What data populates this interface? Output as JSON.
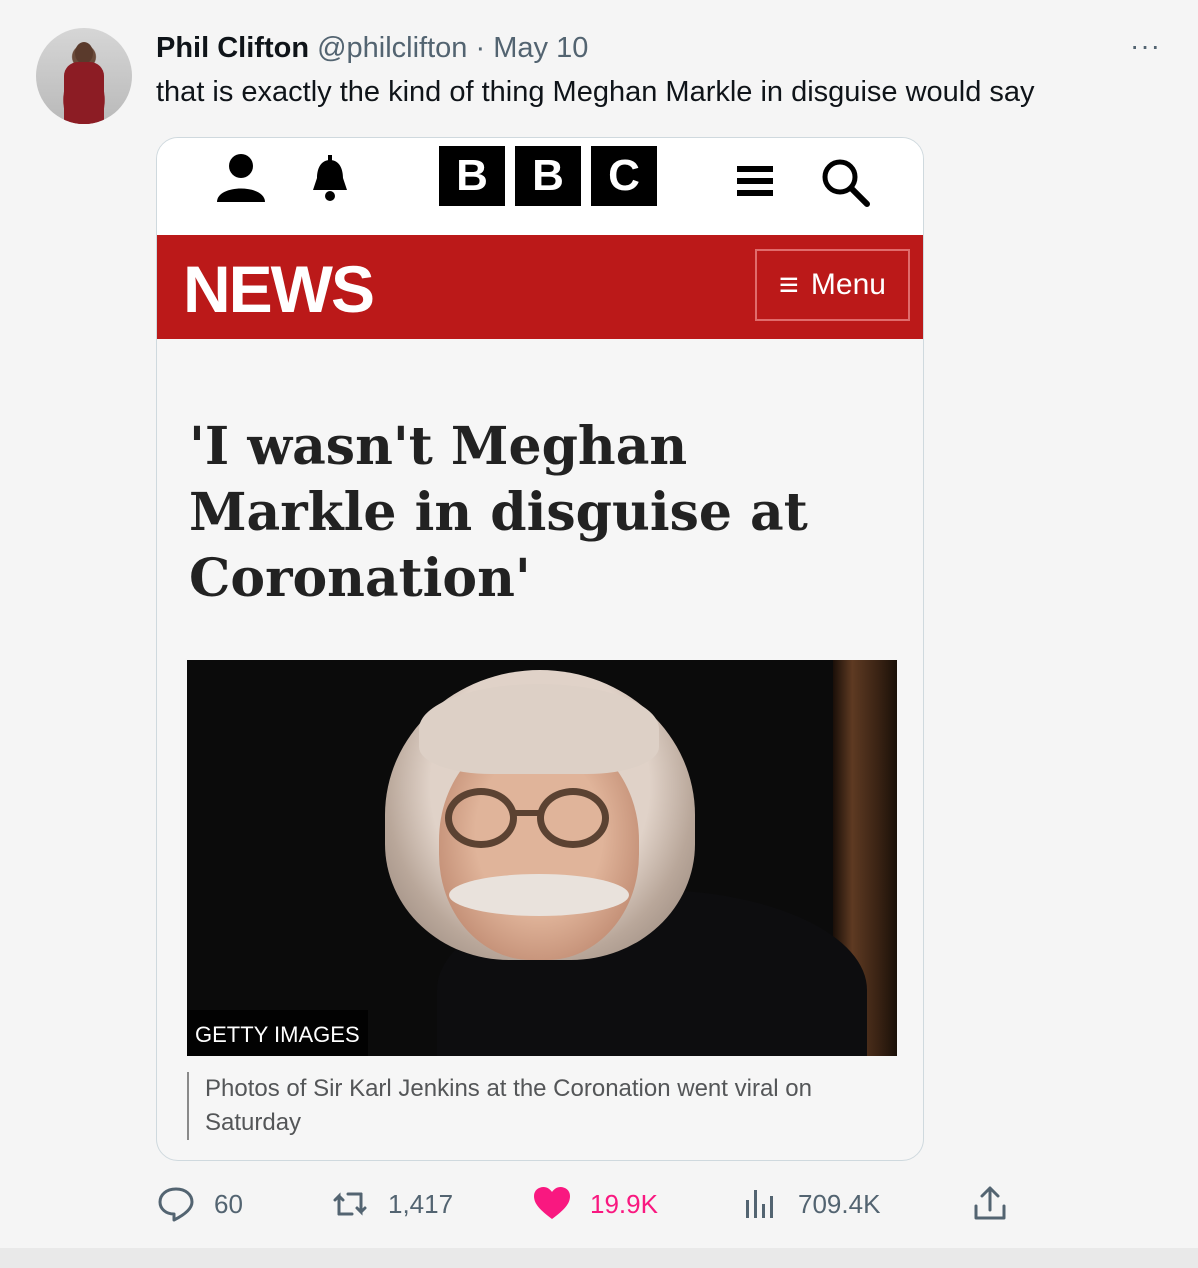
{
  "tweet": {
    "author_name": "Phil Clifton",
    "handle": "@philclifton",
    "separator": "·",
    "date": "May 10",
    "text": "that is exactly the kind of thing Meghan Markle in disguise would say",
    "more_icon": "···"
  },
  "card": {
    "logo_letters": [
      "B",
      "B",
      "C"
    ],
    "news_label": "NEWS",
    "menu_label": "Menu",
    "menu_icon": "≡",
    "headline": "'I wasn't Meghan Markle in disguise at Coronation'",
    "image_credit": "GETTY IMAGES",
    "caption": "Photos of Sir Karl Jenkins at the Coronation went viral on Saturday",
    "colors": {
      "news_red": "#bb1919",
      "like_pink": "#f91880"
    }
  },
  "actions": {
    "replies": "60",
    "retweets": "1,417",
    "likes": "19.9K",
    "views": "709.4K"
  }
}
